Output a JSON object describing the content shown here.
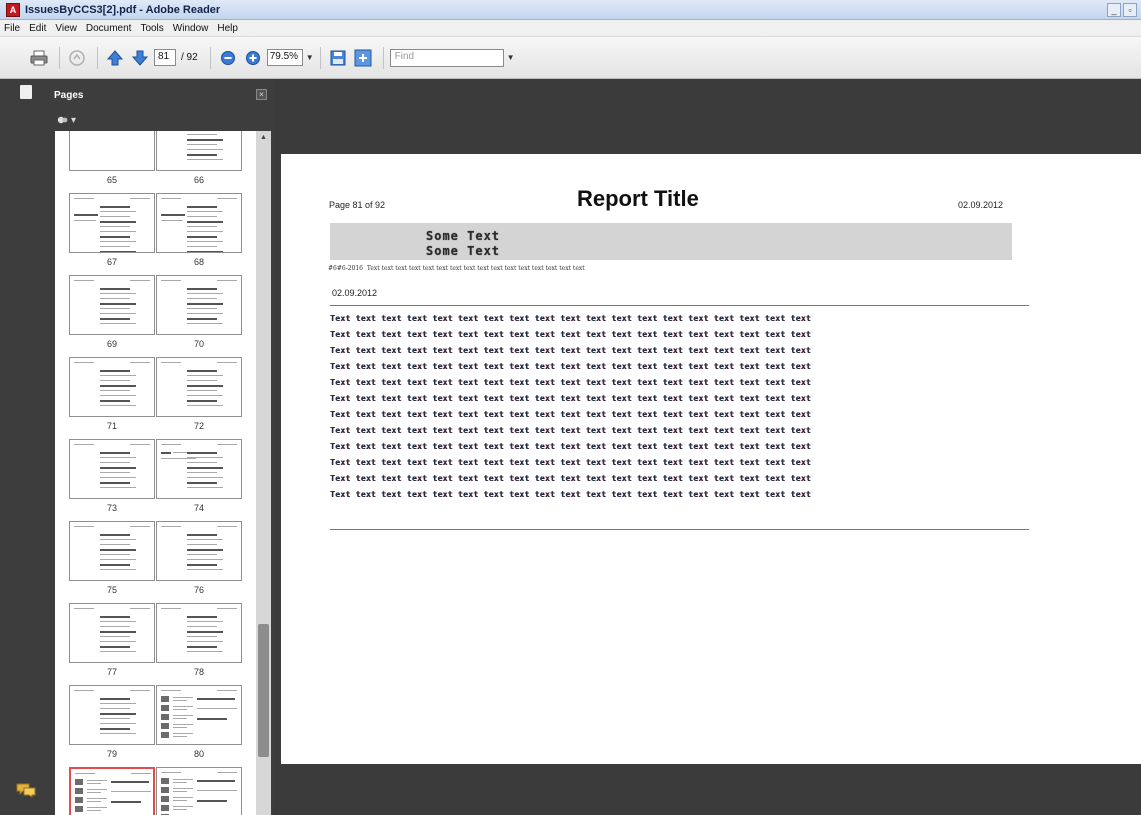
{
  "window": {
    "title": "IssuesByCCS3[2].pdf - Adobe Reader",
    "controls": [
      "_",
      "▫"
    ]
  },
  "menu": [
    "File",
    "Edit",
    "View",
    "Document",
    "Tools",
    "Window",
    "Help"
  ],
  "toolbar": {
    "current_page": "81",
    "page_total": "/ 92",
    "zoom": "79.5%",
    "find_placeholder": "Find",
    "icons": [
      "print-icon",
      "hand-icon",
      "previous-page-icon",
      "next-page-icon",
      "zoom-out-icon",
      "zoom-in-icon",
      "save-icon",
      "fit-page-icon"
    ]
  },
  "pages_panel": {
    "title": "Pages",
    "options_icon": "options-icon",
    "close_symbol": "×",
    "thumbnails": [
      {
        "label": "65",
        "style": "blank"
      },
      {
        "label": "66",
        "style": "text"
      },
      {
        "label": "67",
        "style": "dense"
      },
      {
        "label": "68",
        "style": "dense"
      },
      {
        "label": "69",
        "style": "text"
      },
      {
        "label": "70",
        "style": "text"
      },
      {
        "label": "71",
        "style": "text"
      },
      {
        "label": "72",
        "style": "text"
      },
      {
        "label": "73",
        "style": "text"
      },
      {
        "label": "74",
        "style": "header"
      },
      {
        "label": "75",
        "style": "text"
      },
      {
        "label": "76",
        "style": "text"
      },
      {
        "label": "77",
        "style": "text"
      },
      {
        "label": "78",
        "style": "text"
      },
      {
        "label": "79",
        "style": "text"
      },
      {
        "label": "80",
        "style": "table"
      },
      {
        "label": "",
        "style": "table",
        "selected": true
      },
      {
        "label": "",
        "style": "table"
      }
    ]
  },
  "document": {
    "page_label": "Page  81 of 92",
    "title": "Report Title",
    "date": "02.09.2012",
    "band_lines": [
      "Some Text",
      "Some Text"
    ],
    "info_prefix": "#6#6-2016",
    "info_text": "Text text text text text text text text text text text text text text text text",
    "section_date": "02.09.2012",
    "body_lines": [
      "Text text text text text text text text text text text text text text text text text text text",
      "Text text text text text text text text text text text text text text text text text text text",
      "Text text text text text text text text text text text text text text text text text text text",
      "Text text text text text text text text text text text text text text text text text text text",
      "Text text text text text text text text text text text text text text text text text text text",
      "Text text text text text text text text text text text text text text text text text text text",
      "Text text text text text text text text text text text text text text text text text text text",
      "Text text text text text text text text text text text text text text text text text text text",
      "Text text text text text text text text text text text text text text text text text text text",
      "Text text text text text text text text text text text text text text text text text text text",
      "Text text text text text text text text text text text text text text text text text text text",
      "Text text text text text text text text text text text text text text text text text text text"
    ]
  }
}
